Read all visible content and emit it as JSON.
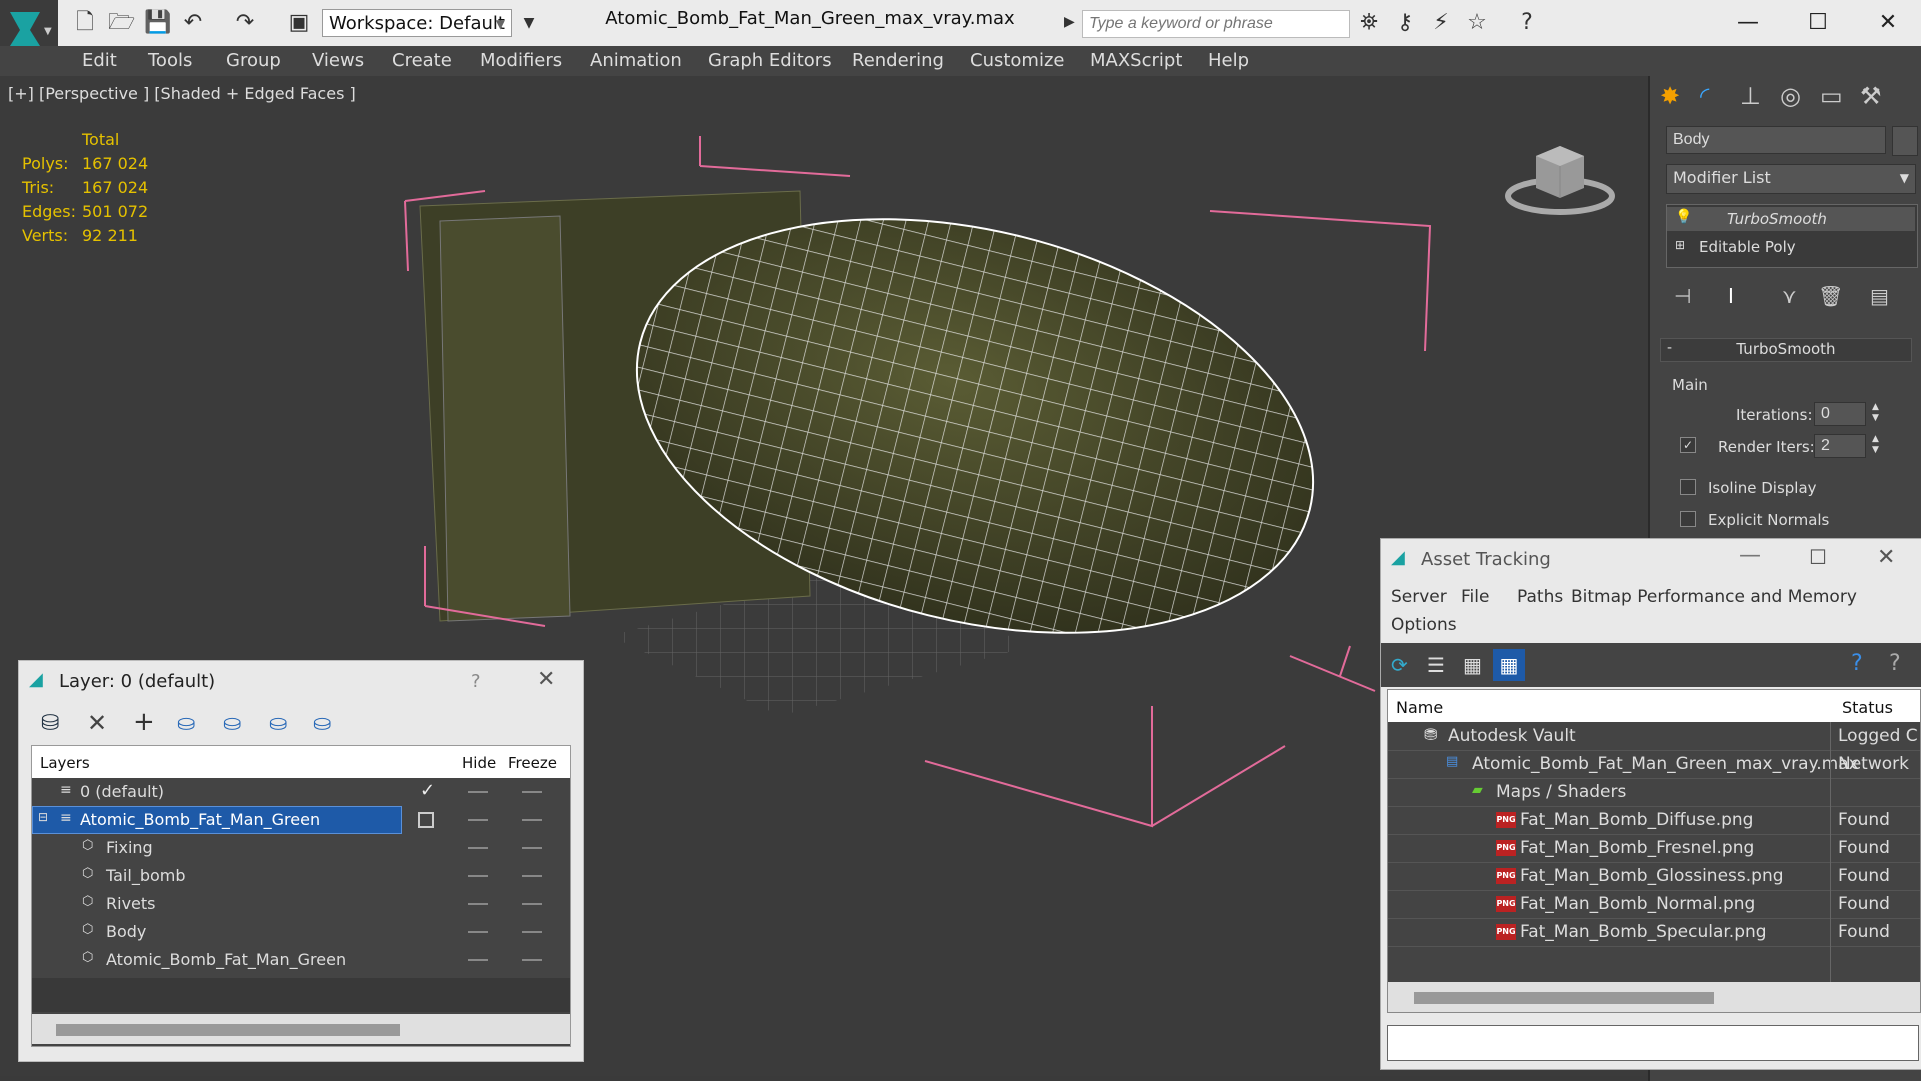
{
  "titlebar": {
    "workspace": "Workspace: Default",
    "file_title": "Atomic_Bomb_Fat_Man_Green_max_vray.max",
    "search_placeholder": "Type a keyword or phrase"
  },
  "menu": [
    "Edit",
    "Tools",
    "Group",
    "Views",
    "Create",
    "Modifiers",
    "Animation",
    "Graph Editors",
    "Rendering",
    "Customize",
    "MAXScript",
    "Help"
  ],
  "viewport": {
    "label": "[+] [Perspective ] [Shaded + Edged Faces ]",
    "stats_header": "Total",
    "stats": [
      {
        "label": "Polys:",
        "value": "167 024"
      },
      {
        "label": "Tris:",
        "value": "167 024"
      },
      {
        "label": "Edges:",
        "value": "501 072"
      },
      {
        "label": "Verts:",
        "value": "92 211"
      }
    ]
  },
  "command_panel": {
    "object_name": "Body",
    "modifier_list": "Modifier List",
    "stack": [
      "TurboSmooth",
      "Editable Poly"
    ],
    "rollout_title": "TurboSmooth",
    "group_main": "Main",
    "iterations_label": "Iterations:",
    "iterations_value": "0",
    "render_iters_label": "Render Iters:",
    "render_iters_value": "2",
    "isoline": "Isoline Display",
    "explicit": "Explicit Normals"
  },
  "layer_panel": {
    "title": "Layer: 0 (default)",
    "help": "?",
    "col_layers": "Layers",
    "col_hide": "Hide",
    "col_freeze": "Freeze",
    "rows": [
      "0 (default)",
      "Atomic_Bomb_Fat_Man_Green",
      "Fixing",
      "Tail_bomb",
      "Rivets",
      "Body",
      "Atomic_Bomb_Fat_Man_Green"
    ]
  },
  "asset_panel": {
    "title": "Asset Tracking",
    "menu": [
      "Server",
      "File",
      "Paths",
      "Bitmap Performance and Memory",
      "Options"
    ],
    "col_name": "Name",
    "col_status": "Status",
    "rows": [
      {
        "name": "Autodesk Vault",
        "status": "Logged C"
      },
      {
        "name": "Atomic_Bomb_Fat_Man_Green_max_vray.max",
        "status": "Network"
      },
      {
        "name": "Maps / Shaders",
        "status": ""
      },
      {
        "name": "Fat_Man_Bomb_Diffuse.png",
        "status": "Found"
      },
      {
        "name": "Fat_Man_Bomb_Fresnel.png",
        "status": "Found"
      },
      {
        "name": "Fat_Man_Bomb_Glossiness.png",
        "status": "Found"
      },
      {
        "name": "Fat_Man_Bomb_Normal.png",
        "status": "Found"
      },
      {
        "name": "Fat_Man_Bomb_Specular.png",
        "status": "Found"
      }
    ]
  },
  "colors": {
    "accent": "#e5c100",
    "selection": "#1e5aa8",
    "bomb": "#4a4c2c"
  }
}
